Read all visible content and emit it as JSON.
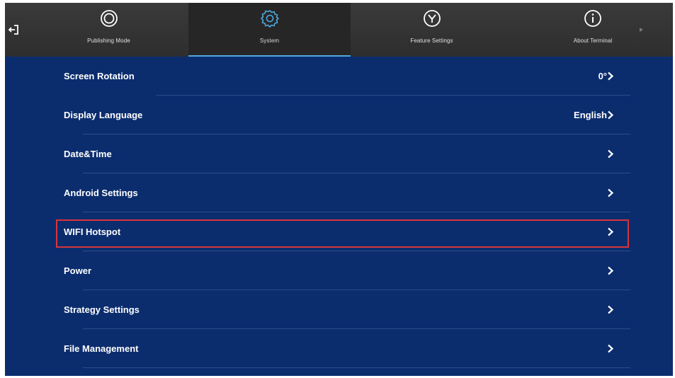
{
  "header": {
    "exit_icon": "exit-icon",
    "tabs": [
      {
        "label": "Publishing Mode",
        "icon": "publishing-mode-icon",
        "active": false
      },
      {
        "label": "System",
        "icon": "gear-icon",
        "active": true
      },
      {
        "label": "Feature Settings",
        "icon": "feature-settings-icon",
        "active": false
      },
      {
        "label": "About Terminal",
        "icon": "info-icon",
        "active": false
      }
    ]
  },
  "settings": {
    "items": [
      {
        "label": "Screen Rotation",
        "value": "0°"
      },
      {
        "label": "Display Language",
        "value": "English"
      },
      {
        "label": "Date&Time",
        "value": ""
      },
      {
        "label": "Android Settings",
        "value": ""
      },
      {
        "label": "WIFI Hotspot",
        "value": ""
      },
      {
        "label": "Power",
        "value": ""
      },
      {
        "label": "Strategy Settings",
        "value": ""
      },
      {
        "label": "File Management",
        "value": ""
      }
    ]
  },
  "colors": {
    "background": "#0b2d6e",
    "topbar": "#333333",
    "active_underline": "#4fa8e0",
    "highlight": "#d8343c"
  }
}
